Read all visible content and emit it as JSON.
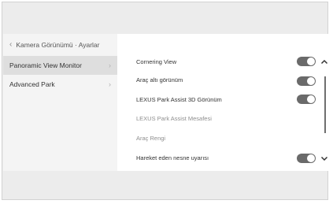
{
  "breadcrumb": {
    "back_icon": "chevron-left-icon",
    "text": "Kamera Görünümü · Ayarlar"
  },
  "sidebar": {
    "items": [
      {
        "label": "Panoramic View Monitor",
        "selected": true
      },
      {
        "label": "Advanced Park",
        "selected": false
      }
    ]
  },
  "settings": {
    "rows": [
      {
        "label": "Cornering View",
        "toggle": true,
        "on": true
      },
      {
        "label": "Araç altı görünüm",
        "toggle": true,
        "on": true
      },
      {
        "label": "LEXUS Park Assist 3D Görünüm",
        "toggle": true,
        "on": true
      },
      {
        "label": "LEXUS Park Assist Mesafesi",
        "toggle": false
      },
      {
        "label": "Araç Rengi",
        "toggle": false
      },
      {
        "label": "Hareket eden nesne uyarısı",
        "toggle": true,
        "on": true
      }
    ]
  },
  "scroll": {
    "up_icon": "chevron-up-icon",
    "down_icon": "chevron-down-icon"
  },
  "colors": {
    "toggle_on": "#6a6a6a",
    "selected_bg": "#dedede",
    "panel_bg": "#f4f4f4"
  }
}
